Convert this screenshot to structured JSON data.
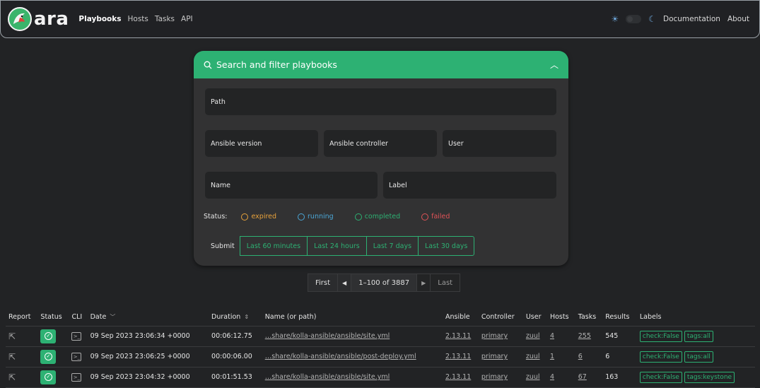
{
  "nav": {
    "brand": "ara",
    "links": [
      "Playbooks",
      "Hosts",
      "Tasks",
      "API"
    ],
    "right_links": [
      "Documentation",
      "About"
    ],
    "accent": "#2db173"
  },
  "filter": {
    "title": "Search and filter playbooks",
    "fields": {
      "path": "Path",
      "ansible_version": "Ansible version",
      "ansible_controller": "Ansible controller",
      "user": "User",
      "name": "Name",
      "label": "Label"
    },
    "status_label": "Status:",
    "statuses": [
      {
        "label": "expired",
        "color": "#e8a23b"
      },
      {
        "label": "running",
        "color": "#4ba6d6"
      },
      {
        "label": "completed",
        "color": "#2db173"
      },
      {
        "label": "failed",
        "color": "#e05357"
      }
    ],
    "submit": "Submit",
    "ranges": [
      "Last 60 minutes",
      "Last 24 hours",
      "Last 7 days",
      "Last 30 days"
    ]
  },
  "pagination": {
    "first": "First",
    "range": "1–100 of 3887",
    "last": "Last"
  },
  "table": {
    "headers": [
      "Report",
      "Status",
      "CLI",
      "Date",
      "Duration",
      "Name (or path)",
      "Ansible",
      "Controller",
      "User",
      "Hosts",
      "Tasks",
      "Results",
      "Labels"
    ],
    "rows": [
      {
        "date": "09 Sep 2023 23:06:34 +0000",
        "duration": "00:06:12.75",
        "path": "…share/kolla-ansible/ansible/site.yml",
        "ansible": "2.13.11",
        "controller": "primary",
        "user": "zuul",
        "hosts": "4",
        "tasks": "255",
        "results": "545",
        "labels": [
          "check:False",
          "tags:all"
        ]
      },
      {
        "date": "09 Sep 2023 23:06:25 +0000",
        "duration": "00:00:06.00",
        "path": "…share/kolla-ansible/ansible/post-deploy.yml",
        "ansible": "2.13.11",
        "controller": "primary",
        "user": "zuul",
        "hosts": "1",
        "tasks": "6",
        "results": "6",
        "labels": [
          "check:False",
          "tags:all"
        ]
      },
      {
        "date": "09 Sep 2023 23:04:32 +0000",
        "duration": "00:01:51.53",
        "path": "…share/kolla-ansible/ansible/site.yml",
        "ansible": "2.13.11",
        "controller": "primary",
        "user": "zuul",
        "hosts": "4",
        "tasks": "67",
        "results": "163",
        "labels": [
          "check:False",
          "tags:keystone"
        ]
      }
    ]
  }
}
